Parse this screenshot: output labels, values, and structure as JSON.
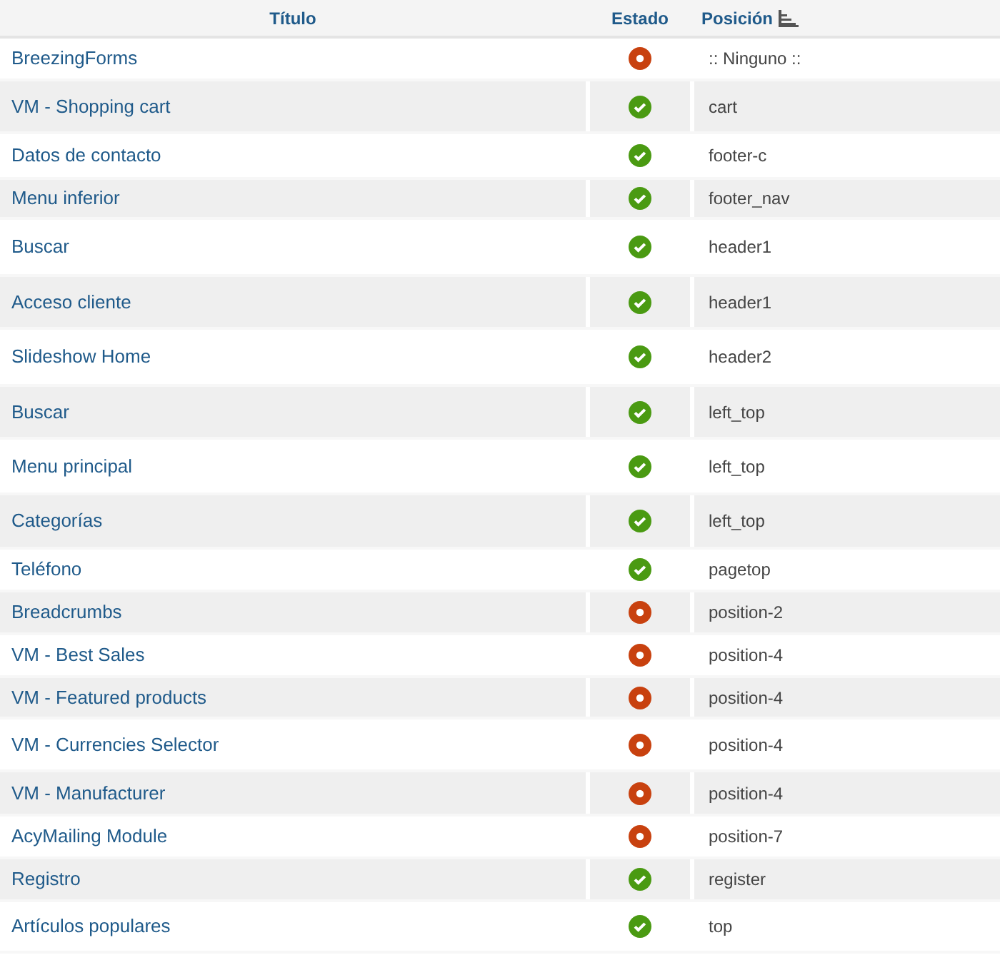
{
  "table": {
    "columns": [
      {
        "label": "Título"
      },
      {
        "label": "Estado"
      },
      {
        "label": "Posición",
        "sorted": true
      }
    ],
    "rows": [
      {
        "title": "BreezingForms",
        "enabled": false,
        "position": ":: Ninguno ::"
      },
      {
        "title": "VM - Shopping cart",
        "enabled": true,
        "position": "cart"
      },
      {
        "title": "Datos de contacto",
        "enabled": true,
        "position": "footer-c"
      },
      {
        "title": "Menu inferior",
        "enabled": true,
        "position": "footer_nav"
      },
      {
        "title": "Buscar",
        "enabled": true,
        "position": "header1"
      },
      {
        "title": "Acceso cliente",
        "enabled": true,
        "position": "header1"
      },
      {
        "title": "Slideshow Home",
        "enabled": true,
        "position": "header2"
      },
      {
        "title": "Buscar",
        "enabled": true,
        "position": "left_top"
      },
      {
        "title": "Menu principal",
        "enabled": true,
        "position": "left_top"
      },
      {
        "title": "Categorías",
        "enabled": true,
        "position": "left_top"
      },
      {
        "title": "Teléfono",
        "enabled": true,
        "position": "pagetop"
      },
      {
        "title": "Breadcrumbs",
        "enabled": false,
        "position": "position-2"
      },
      {
        "title": "VM - Best Sales",
        "enabled": false,
        "position": "position-4"
      },
      {
        "title": "VM - Featured products",
        "enabled": false,
        "position": "position-4"
      },
      {
        "title": "VM - Currencies Selector",
        "enabled": false,
        "position": "position-4"
      },
      {
        "title": "VM - Manufacturer",
        "enabled": false,
        "position": "position-4"
      },
      {
        "title": "AcyMailing Module",
        "enabled": false,
        "position": "position-7"
      },
      {
        "title": "Registro",
        "enabled": true,
        "position": "register"
      },
      {
        "title": "Artículos populares",
        "enabled": true,
        "position": "top"
      }
    ]
  }
}
